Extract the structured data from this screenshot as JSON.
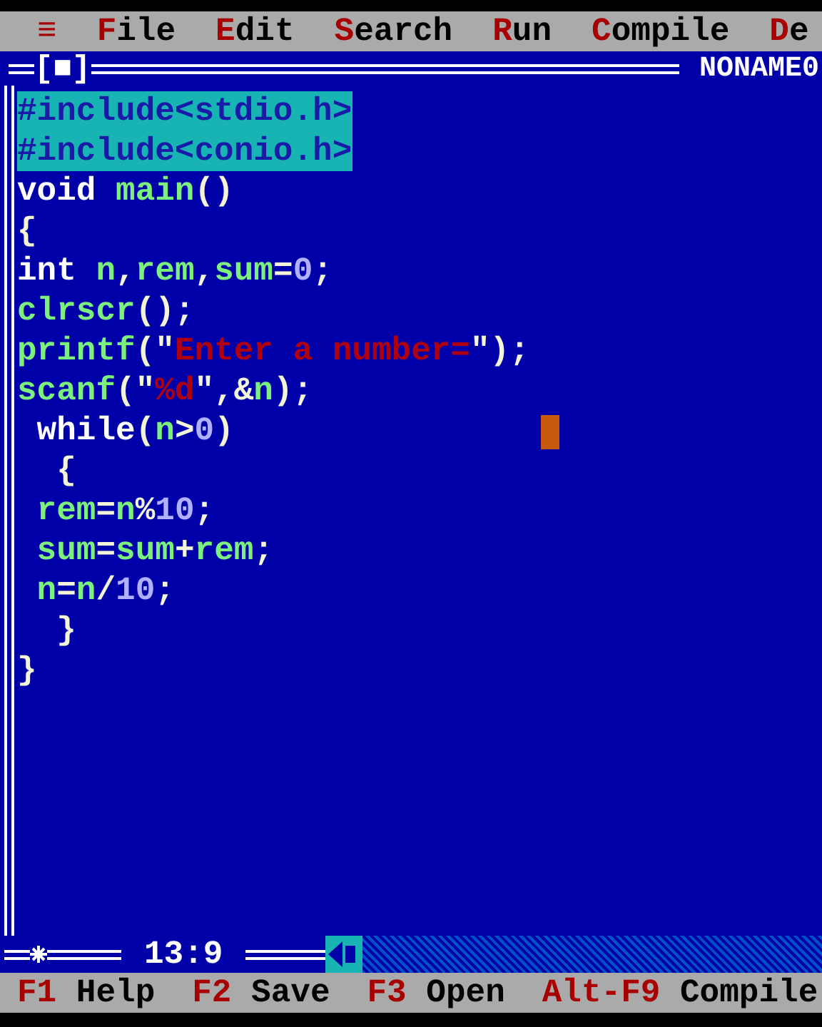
{
  "menu_bar": {
    "items": [
      {
        "label": "≡"
      },
      {
        "label": "File"
      },
      {
        "label": "Edit"
      },
      {
        "label": "Search"
      },
      {
        "label": "Run"
      },
      {
        "label": "Compile"
      },
      {
        "label": "De"
      }
    ]
  },
  "editor": {
    "close_box": "[■]",
    "title": "NONAME0",
    "position": "13:9",
    "lines": [
      {
        "selected": true,
        "cursor": false,
        "tokens": [
          {
            "kind": "plain",
            "text": "#include<stdio.h>"
          }
        ]
      },
      {
        "selected": true,
        "cursor": false,
        "tokens": [
          {
            "kind": "plain",
            "text": "#include<conio.h>"
          }
        ]
      },
      {
        "selected": false,
        "cursor": false,
        "tokens": [
          {
            "kind": "keyword",
            "text": "void "
          },
          {
            "kind": "ident",
            "text": "main"
          },
          {
            "kind": "symbol",
            "text": "()"
          }
        ]
      },
      {
        "selected": false,
        "cursor": false,
        "tokens": [
          {
            "kind": "symbol",
            "text": "{"
          }
        ]
      },
      {
        "selected": false,
        "cursor": false,
        "tokens": [
          {
            "kind": "keyword",
            "text": "int "
          },
          {
            "kind": "ident",
            "text": "n"
          },
          {
            "kind": "symbol",
            "text": ","
          },
          {
            "kind": "ident",
            "text": "rem"
          },
          {
            "kind": "symbol",
            "text": ","
          },
          {
            "kind": "ident",
            "text": "sum"
          },
          {
            "kind": "symbol",
            "text": "="
          },
          {
            "kind": "number",
            "text": "0"
          },
          {
            "kind": "symbol",
            "text": ";"
          }
        ]
      },
      {
        "selected": false,
        "cursor": false,
        "tokens": [
          {
            "kind": "ident",
            "text": "clrscr"
          },
          {
            "kind": "symbol",
            "text": "();"
          }
        ]
      },
      {
        "selected": false,
        "cursor": false,
        "tokens": [
          {
            "kind": "ident",
            "text": "printf"
          },
          {
            "kind": "symbol",
            "text": "(\""
          },
          {
            "kind": "string",
            "text": "Enter a number="
          },
          {
            "kind": "symbol",
            "text": "\");"
          }
        ]
      },
      {
        "selected": false,
        "cursor": false,
        "tokens": [
          {
            "kind": "ident",
            "text": "scanf"
          },
          {
            "kind": "symbol",
            "text": "(\""
          },
          {
            "kind": "string",
            "text": "%d"
          },
          {
            "kind": "symbol",
            "text": "\",&"
          },
          {
            "kind": "ident",
            "text": "n"
          },
          {
            "kind": "symbol",
            "text": ");"
          }
        ]
      },
      {
        "selected": false,
        "cursor": true,
        "tokens": [
          {
            "kind": "keyword",
            "text": " while"
          },
          {
            "kind": "symbol",
            "text": "("
          },
          {
            "kind": "ident",
            "text": "n"
          },
          {
            "kind": "symbol",
            "text": ">"
          },
          {
            "kind": "number",
            "text": "0"
          },
          {
            "kind": "symbol",
            "text": ")"
          }
        ]
      },
      {
        "selected": false,
        "cursor": false,
        "tokens": [
          {
            "kind": "symbol",
            "text": "  {"
          }
        ]
      },
      {
        "selected": false,
        "cursor": false,
        "tokens": [
          {
            "kind": "ident",
            "text": " rem"
          },
          {
            "kind": "symbol",
            "text": "="
          },
          {
            "kind": "ident",
            "text": "n"
          },
          {
            "kind": "symbol",
            "text": "%"
          },
          {
            "kind": "number",
            "text": "10"
          },
          {
            "kind": "symbol",
            "text": ";"
          }
        ]
      },
      {
        "selected": false,
        "cursor": false,
        "tokens": [
          {
            "kind": "ident",
            "text": " sum"
          },
          {
            "kind": "symbol",
            "text": "="
          },
          {
            "kind": "ident",
            "text": "sum"
          },
          {
            "kind": "symbol",
            "text": "+"
          },
          {
            "kind": "ident",
            "text": "rem"
          },
          {
            "kind": "symbol",
            "text": ";"
          }
        ]
      },
      {
        "selected": false,
        "cursor": false,
        "tokens": [
          {
            "kind": "ident",
            "text": " n"
          },
          {
            "kind": "symbol",
            "text": "="
          },
          {
            "kind": "ident",
            "text": "n"
          },
          {
            "kind": "symbol",
            "text": "/"
          },
          {
            "kind": "number",
            "text": "10"
          },
          {
            "kind": "symbol",
            "text": ";"
          }
        ]
      },
      {
        "selected": false,
        "cursor": false,
        "tokens": [
          {
            "kind": "symbol",
            "text": "  }"
          }
        ]
      },
      {
        "selected": false,
        "cursor": false,
        "tokens": [
          {
            "kind": "symbol",
            "text": "}"
          }
        ]
      }
    ]
  },
  "status_bar": {
    "items": [
      {
        "key": "F1",
        "label": "Help"
      },
      {
        "key": "F2",
        "label": "Save"
      },
      {
        "key": "F3",
        "label": "Open"
      },
      {
        "key": "Alt-F9",
        "label": "Compile"
      }
    ]
  }
}
